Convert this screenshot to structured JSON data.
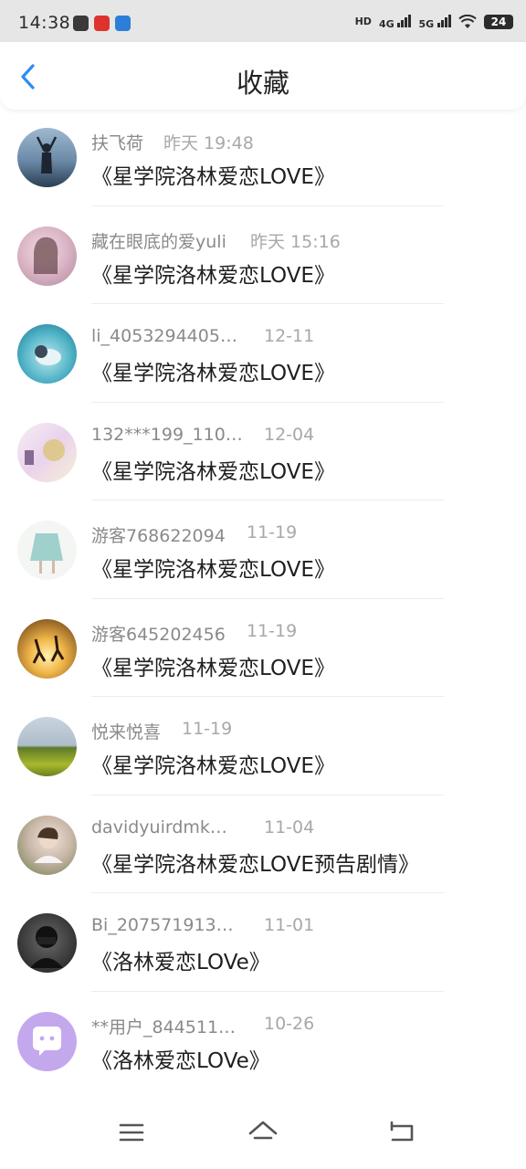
{
  "status": {
    "time": "14:38",
    "battery": "24",
    "hd": "HD",
    "net1": "4G",
    "net2": "5G"
  },
  "header": {
    "title": "收藏"
  },
  "items": [
    {
      "name": "扶飞荷",
      "time": "昨天 19:48",
      "message": "《星学院洛林爱恋LOVE》"
    },
    {
      "name": "藏在眼底的爱yuli",
      "time": "昨天 15:16",
      "message": "《星学院洛林爱恋LOVE》"
    },
    {
      "name": "li_4053294405…",
      "time": "12-11",
      "message": "《星学院洛林爱恋LOVE》"
    },
    {
      "name": "132***199_110…",
      "time": "12-04",
      "message": "《星学院洛林爱恋LOVE》"
    },
    {
      "name": "游客768622094",
      "time": "11-19",
      "message": "《星学院洛林爱恋LOVE》"
    },
    {
      "name": "游客645202456",
      "time": "11-19",
      "message": "《星学院洛林爱恋LOVE》"
    },
    {
      "name": "悦来悦喜",
      "time": "11-19",
      "message": "《星学院洛林爱恋LOVE》"
    },
    {
      "name": "davidyuirdmk…",
      "time": "11-04",
      "message": "《星学院洛林爱恋LOVE预告剧情》"
    },
    {
      "name": "Bi_207571913…",
      "time": "11-01",
      "message": "《洛林爱恋LOVe》"
    },
    {
      "name": "**用户_844511…",
      "time": "10-26",
      "message": "《洛林爱恋LOVe》"
    }
  ],
  "colors": {
    "accent": "#2f8cf0",
    "status_bg": "#e6e6e6"
  },
  "icons": {
    "back": "chevron-left-icon",
    "menu": "menu-icon",
    "home": "home-icon",
    "return": "return-icon"
  }
}
